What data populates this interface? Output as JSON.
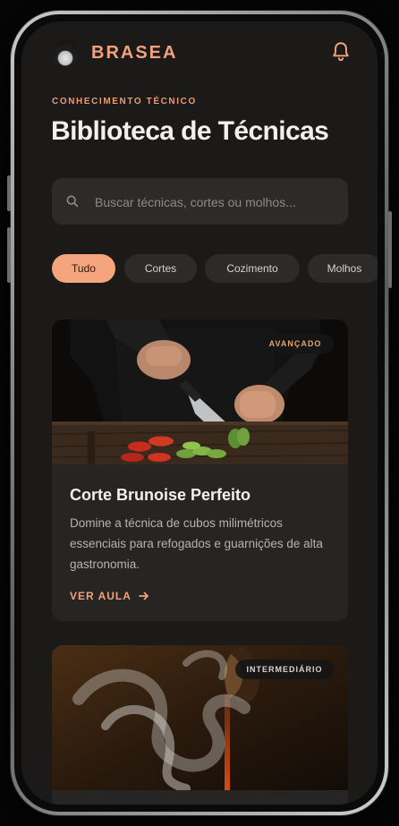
{
  "app": {
    "brand": "BRASEA"
  },
  "page": {
    "eyebrow": "CONHECIMENTO TÉCNICO",
    "title": "Biblioteca de Técnicas"
  },
  "search": {
    "placeholder": "Buscar técnicas, cortes ou molhos..."
  },
  "filters": [
    {
      "label": "Tudo",
      "active": true
    },
    {
      "label": "Cortes",
      "active": false
    },
    {
      "label": "Cozimento",
      "active": false
    },
    {
      "label": "Molhos",
      "active": false
    }
  ],
  "cards": [
    {
      "badge": "AVANÇADO",
      "title": "Corte Brunoise Perfeito",
      "description": "Domine a técnica de cubos milimétricos essenciais para refogados e guarnições de alta gastronomia.",
      "cta": "VER AULA"
    },
    {
      "badge": "INTERMEDIÁRIO"
    }
  ],
  "colors": {
    "accent": "#f2a27a",
    "active_chip": "#f5a57d",
    "surface": "#262524",
    "background": "#1b1a19"
  },
  "icons": {
    "notification": "bell-icon",
    "search": "search-icon",
    "cta_arrow": "arrow-right-icon"
  }
}
